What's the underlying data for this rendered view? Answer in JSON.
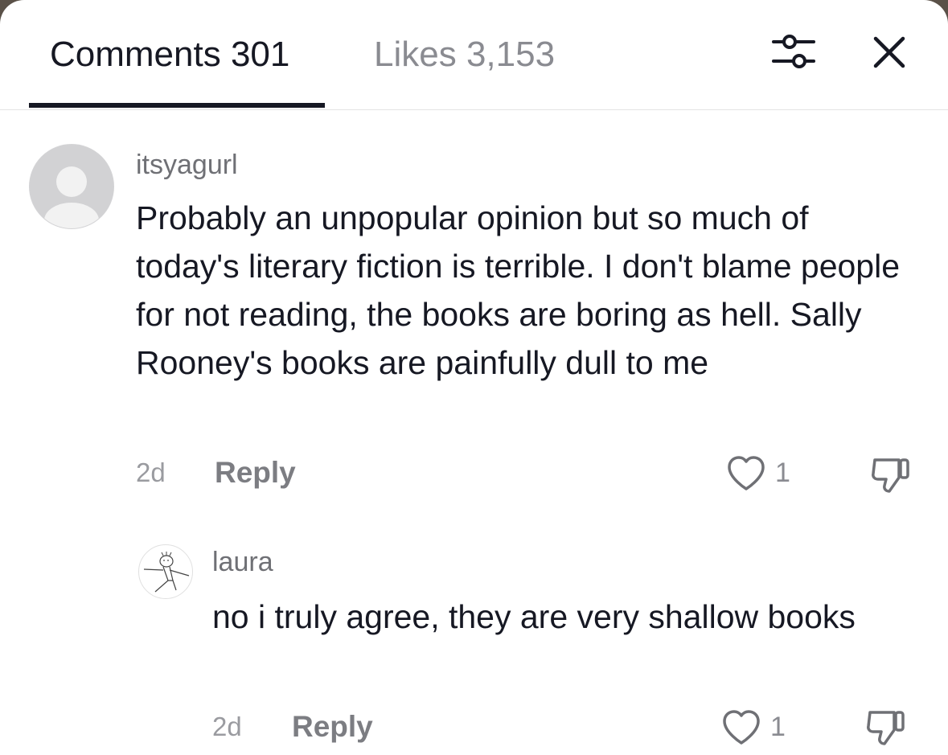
{
  "header": {
    "tabs": [
      {
        "label": "Comments 301",
        "active": true
      },
      {
        "label": "Likes 3,153",
        "active": false
      }
    ],
    "icons": [
      "filter-sliders-icon",
      "close-icon"
    ]
  },
  "comments": [
    {
      "username": "itsyagurl",
      "text": "Probably an unpopular opinion but so much of today's literary fiction is terrible. I don't blame people for not reading, the books are boring as hell. Sally Rooney's books are painfully dull to me",
      "time": "2d",
      "reply_label": "Reply",
      "likes": "1",
      "avatar": "default-avatar-icon"
    },
    {
      "username": "laura",
      "text": "no i truly agree, they are very shallow books",
      "time": "2d",
      "reply_label": "Reply",
      "likes": "1",
      "avatar": "doodle-avatar"
    }
  ],
  "colors": {
    "primary_text": "#161823",
    "secondary_text": "#8a8b91",
    "divider": "#e3e3e3",
    "background": "#ffffff"
  }
}
